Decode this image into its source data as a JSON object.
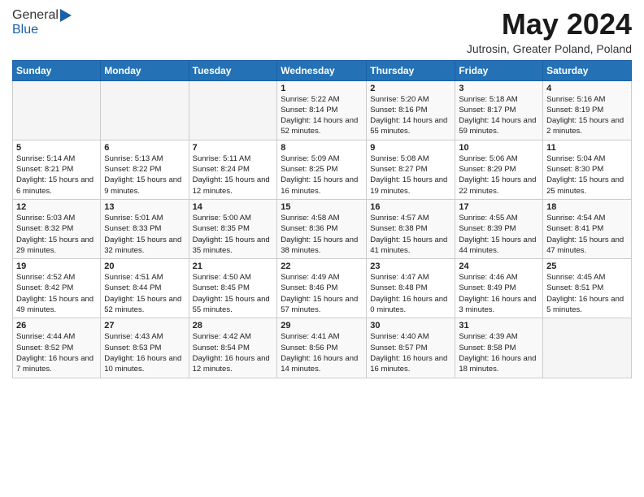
{
  "header": {
    "logo_general": "General",
    "logo_blue": "Blue",
    "month_title": "May 2024",
    "subtitle": "Jutrosin, Greater Poland, Poland"
  },
  "days_of_week": [
    "Sunday",
    "Monday",
    "Tuesday",
    "Wednesday",
    "Thursday",
    "Friday",
    "Saturday"
  ],
  "weeks": [
    [
      {
        "day": "",
        "info": ""
      },
      {
        "day": "",
        "info": ""
      },
      {
        "day": "",
        "info": ""
      },
      {
        "day": "1",
        "info": "Sunrise: 5:22 AM\nSunset: 8:14 PM\nDaylight: 14 hours and 52 minutes."
      },
      {
        "day": "2",
        "info": "Sunrise: 5:20 AM\nSunset: 8:16 PM\nDaylight: 14 hours and 55 minutes."
      },
      {
        "day": "3",
        "info": "Sunrise: 5:18 AM\nSunset: 8:17 PM\nDaylight: 14 hours and 59 minutes."
      },
      {
        "day": "4",
        "info": "Sunrise: 5:16 AM\nSunset: 8:19 PM\nDaylight: 15 hours and 2 minutes."
      }
    ],
    [
      {
        "day": "5",
        "info": "Sunrise: 5:14 AM\nSunset: 8:21 PM\nDaylight: 15 hours and 6 minutes."
      },
      {
        "day": "6",
        "info": "Sunrise: 5:13 AM\nSunset: 8:22 PM\nDaylight: 15 hours and 9 minutes."
      },
      {
        "day": "7",
        "info": "Sunrise: 5:11 AM\nSunset: 8:24 PM\nDaylight: 15 hours and 12 minutes."
      },
      {
        "day": "8",
        "info": "Sunrise: 5:09 AM\nSunset: 8:25 PM\nDaylight: 15 hours and 16 minutes."
      },
      {
        "day": "9",
        "info": "Sunrise: 5:08 AM\nSunset: 8:27 PM\nDaylight: 15 hours and 19 minutes."
      },
      {
        "day": "10",
        "info": "Sunrise: 5:06 AM\nSunset: 8:29 PM\nDaylight: 15 hours and 22 minutes."
      },
      {
        "day": "11",
        "info": "Sunrise: 5:04 AM\nSunset: 8:30 PM\nDaylight: 15 hours and 25 minutes."
      }
    ],
    [
      {
        "day": "12",
        "info": "Sunrise: 5:03 AM\nSunset: 8:32 PM\nDaylight: 15 hours and 29 minutes."
      },
      {
        "day": "13",
        "info": "Sunrise: 5:01 AM\nSunset: 8:33 PM\nDaylight: 15 hours and 32 minutes."
      },
      {
        "day": "14",
        "info": "Sunrise: 5:00 AM\nSunset: 8:35 PM\nDaylight: 15 hours and 35 minutes."
      },
      {
        "day": "15",
        "info": "Sunrise: 4:58 AM\nSunset: 8:36 PM\nDaylight: 15 hours and 38 minutes."
      },
      {
        "day": "16",
        "info": "Sunrise: 4:57 AM\nSunset: 8:38 PM\nDaylight: 15 hours and 41 minutes."
      },
      {
        "day": "17",
        "info": "Sunrise: 4:55 AM\nSunset: 8:39 PM\nDaylight: 15 hours and 44 minutes."
      },
      {
        "day": "18",
        "info": "Sunrise: 4:54 AM\nSunset: 8:41 PM\nDaylight: 15 hours and 47 minutes."
      }
    ],
    [
      {
        "day": "19",
        "info": "Sunrise: 4:52 AM\nSunset: 8:42 PM\nDaylight: 15 hours and 49 minutes."
      },
      {
        "day": "20",
        "info": "Sunrise: 4:51 AM\nSunset: 8:44 PM\nDaylight: 15 hours and 52 minutes."
      },
      {
        "day": "21",
        "info": "Sunrise: 4:50 AM\nSunset: 8:45 PM\nDaylight: 15 hours and 55 minutes."
      },
      {
        "day": "22",
        "info": "Sunrise: 4:49 AM\nSunset: 8:46 PM\nDaylight: 15 hours and 57 minutes."
      },
      {
        "day": "23",
        "info": "Sunrise: 4:47 AM\nSunset: 8:48 PM\nDaylight: 16 hours and 0 minutes."
      },
      {
        "day": "24",
        "info": "Sunrise: 4:46 AM\nSunset: 8:49 PM\nDaylight: 16 hours and 3 minutes."
      },
      {
        "day": "25",
        "info": "Sunrise: 4:45 AM\nSunset: 8:51 PM\nDaylight: 16 hours and 5 minutes."
      }
    ],
    [
      {
        "day": "26",
        "info": "Sunrise: 4:44 AM\nSunset: 8:52 PM\nDaylight: 16 hours and 7 minutes."
      },
      {
        "day": "27",
        "info": "Sunrise: 4:43 AM\nSunset: 8:53 PM\nDaylight: 16 hours and 10 minutes."
      },
      {
        "day": "28",
        "info": "Sunrise: 4:42 AM\nSunset: 8:54 PM\nDaylight: 16 hours and 12 minutes."
      },
      {
        "day": "29",
        "info": "Sunrise: 4:41 AM\nSunset: 8:56 PM\nDaylight: 16 hours and 14 minutes."
      },
      {
        "day": "30",
        "info": "Sunrise: 4:40 AM\nSunset: 8:57 PM\nDaylight: 16 hours and 16 minutes."
      },
      {
        "day": "31",
        "info": "Sunrise: 4:39 AM\nSunset: 8:58 PM\nDaylight: 16 hours and 18 minutes."
      },
      {
        "day": "",
        "info": ""
      }
    ]
  ]
}
